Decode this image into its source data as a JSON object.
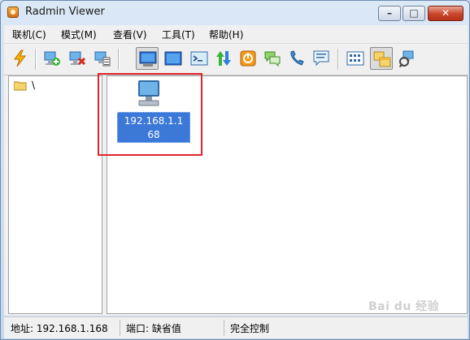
{
  "window": {
    "title": "Radmin Viewer"
  },
  "window_controls": {
    "minimize": "–",
    "maximize": "□",
    "close": "✕"
  },
  "menu": [
    "联机(C)",
    "模式(M)",
    "查看(V)",
    "工具(T)",
    "帮助(H)"
  ],
  "toolbar": {
    "buttons": [
      "connect-icon",
      "add-connection-icon",
      "delete-connection-icon",
      "properties-icon",
      "full-control-icon",
      "view-only-icon",
      "telnet-icon",
      "file-transfer-icon",
      "shutdown-icon",
      "chat-icon",
      "voice-chat-icon",
      "message-icon",
      "large-icons-icon",
      "folder-view-icon",
      "network-scan-icon"
    ],
    "pressed": [
      "full-control-icon",
      "folder-view-icon"
    ]
  },
  "tree": {
    "root_label": "\\"
  },
  "connection": {
    "label_line1": "192.168.1.1",
    "label_line2": "68"
  },
  "status": {
    "address": "地址: 192.168.1.168",
    "port": "端口: 缺省值",
    "mode": "完全控制"
  },
  "watermark": {
    "text": "Bai du 经验"
  },
  "colors": {
    "selection": "#3b78d8",
    "highlight_box": "#e0242b",
    "title_bar": "#c4d8ee"
  }
}
